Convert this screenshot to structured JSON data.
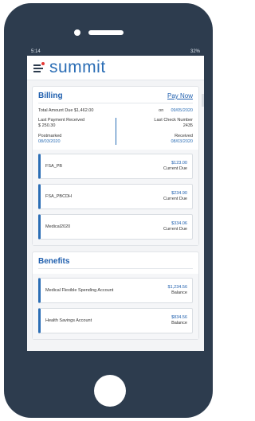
{
  "status_bar": {
    "time": "5:14",
    "right": "32%"
  },
  "app": {
    "logo": "summit"
  },
  "billing": {
    "title": "Billing",
    "pay_now": "Pay Now",
    "total_label": "Total Amount Due",
    "total_value": "$1,462.00",
    "on_label": "on",
    "due_date": "09/05/2020",
    "last_payment_label": "Last Payment Received",
    "last_payment_value": "$ 250.30",
    "last_check_label": "Last Check Number",
    "last_check_value": "2435",
    "postmarked_label": "Postmarked",
    "postmarked_value": "08/03/2020",
    "received_label": "Received",
    "received_value": "08/03/2020",
    "items": [
      {
        "name": "FSA_PB",
        "amount": "$123.00",
        "sub": "Current Due"
      },
      {
        "name": "FSA_PBCDH",
        "amount": "$234.90",
        "sub": "Current Due"
      },
      {
        "name": "Medical2020",
        "amount": "$334.06",
        "sub": "Current Due"
      }
    ]
  },
  "benefits": {
    "title": "Benefits",
    "items": [
      {
        "name": "Medical Flexible Spending Account",
        "amount": "$1,234.56",
        "sub": "Balance"
      },
      {
        "name": "Health Savings Account",
        "amount": "$834.56",
        "sub": "Balance"
      }
    ]
  }
}
